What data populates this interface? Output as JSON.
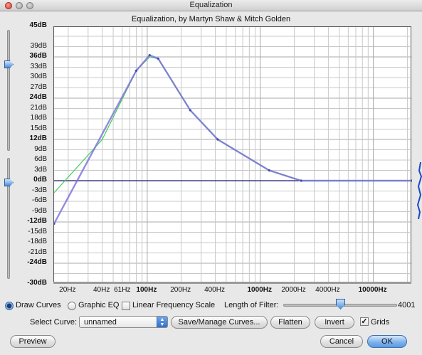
{
  "window": {
    "title": "Equalization",
    "subtitle": "Equalization, by Martyn Shaw & Mitch Golden"
  },
  "graph": {
    "y_labels": [
      {
        "text": "45dB",
        "db": 45,
        "bold": true
      },
      {
        "text": "39dB",
        "db": 39,
        "bold": false
      },
      {
        "text": "36dB",
        "db": 36,
        "bold": true
      },
      {
        "text": "33dB",
        "db": 33,
        "bold": false
      },
      {
        "text": "30dB",
        "db": 30,
        "bold": false
      },
      {
        "text": "27dB",
        "db": 27,
        "bold": false
      },
      {
        "text": "24dB",
        "db": 24,
        "bold": true
      },
      {
        "text": "21dB",
        "db": 21,
        "bold": false
      },
      {
        "text": "18dB",
        "db": 18,
        "bold": false
      },
      {
        "text": "15dB",
        "db": 15,
        "bold": false
      },
      {
        "text": "12dB",
        "db": 12,
        "bold": true
      },
      {
        "text": "9dB",
        "db": 9,
        "bold": false
      },
      {
        "text": "6dB",
        "db": 6,
        "bold": false
      },
      {
        "text": "3dB",
        "db": 3,
        "bold": false
      },
      {
        "text": "0dB",
        "db": 0,
        "bold": true
      },
      {
        "text": "-3dB",
        "db": -3,
        "bold": false
      },
      {
        "text": "-6dB",
        "db": -6,
        "bold": false
      },
      {
        "text": "-9dB",
        "db": -9,
        "bold": false
      },
      {
        "text": "-12dB",
        "db": -12,
        "bold": true
      },
      {
        "text": "-15dB",
        "db": -15,
        "bold": false
      },
      {
        "text": "-18dB",
        "db": -18,
        "bold": false
      },
      {
        "text": "-21dB",
        "db": -21,
        "bold": false
      },
      {
        "text": "-24dB",
        "db": -24,
        "bold": true
      },
      {
        "text": "-30dB",
        "db": -30,
        "bold": true
      }
    ],
    "x_labels": [
      {
        "text": "20Hz",
        "hz": 20,
        "bold": false
      },
      {
        "text": "40Hz",
        "hz": 40,
        "bold": false
      },
      {
        "text": "61Hz",
        "hz": 61,
        "bold": false
      },
      {
        "text": "100Hz",
        "hz": 100,
        "bold": true
      },
      {
        "text": "200Hz",
        "hz": 200,
        "bold": false
      },
      {
        "text": "400Hz",
        "hz": 400,
        "bold": false
      },
      {
        "text": "1000Hz",
        "hz": 1000,
        "bold": true
      },
      {
        "text": "2000Hz",
        "hz": 2000,
        "bold": false
      },
      {
        "text": "4000Hz",
        "hz": 4000,
        "bold": false
      },
      {
        "text": "10000Hz",
        "hz": 10000,
        "bold": true
      }
    ],
    "x_range_hz": [
      15,
      22000
    ],
    "y_range_db": [
      -30,
      45
    ],
    "curve_points": [
      {
        "hz": 15,
        "db": -12.5
      },
      {
        "hz": 80,
        "db": 32
      },
      {
        "hz": 105,
        "db": 36.5
      },
      {
        "hz": 125,
        "db": 35.5
      },
      {
        "hz": 240,
        "db": 20.5
      },
      {
        "hz": 420,
        "db": 12
      },
      {
        "hz": 1200,
        "db": 3
      },
      {
        "hz": 2300,
        "db": 0
      },
      {
        "hz": 22000,
        "db": 0
      }
    ],
    "response_points": [
      {
        "hz": 15,
        "db": -3.5
      },
      {
        "hz": 40,
        "db": 12
      },
      {
        "hz": 80,
        "db": 32
      },
      {
        "hz": 105,
        "db": 36
      },
      {
        "hz": 125,
        "db": 35.5
      },
      {
        "hz": 240,
        "db": 20.5
      },
      {
        "hz": 420,
        "db": 12
      },
      {
        "hz": 1200,
        "db": 3
      },
      {
        "hz": 2300,
        "db": 0
      },
      {
        "hz": 22000,
        "db": 0
      }
    ],
    "colors": {
      "curve": "#7b6fd8",
      "response": "#3ecf5c",
      "zero_line": "#1a1a6b",
      "grid": "#c8c8c8",
      "grid_major": "#a8a8a8"
    }
  },
  "controls": {
    "draw_curves_label": "Draw Curves",
    "graphic_eq_label": "Graphic EQ",
    "linear_freq_label": "Linear Frequency Scale",
    "length_label": "Length of Filter:",
    "length_value": "4001",
    "length_fraction": 0.5,
    "select_curve_label": "Select Curve:",
    "select_curve_value": "unnamed",
    "save_manage_label": "Save/Manage Curves...",
    "flatten_label": "Flatten",
    "invert_label": "Invert",
    "grids_label": "Grids",
    "grids_checked": true,
    "preview_label": "Preview",
    "cancel_label": "Cancel",
    "ok_label": "OK"
  }
}
